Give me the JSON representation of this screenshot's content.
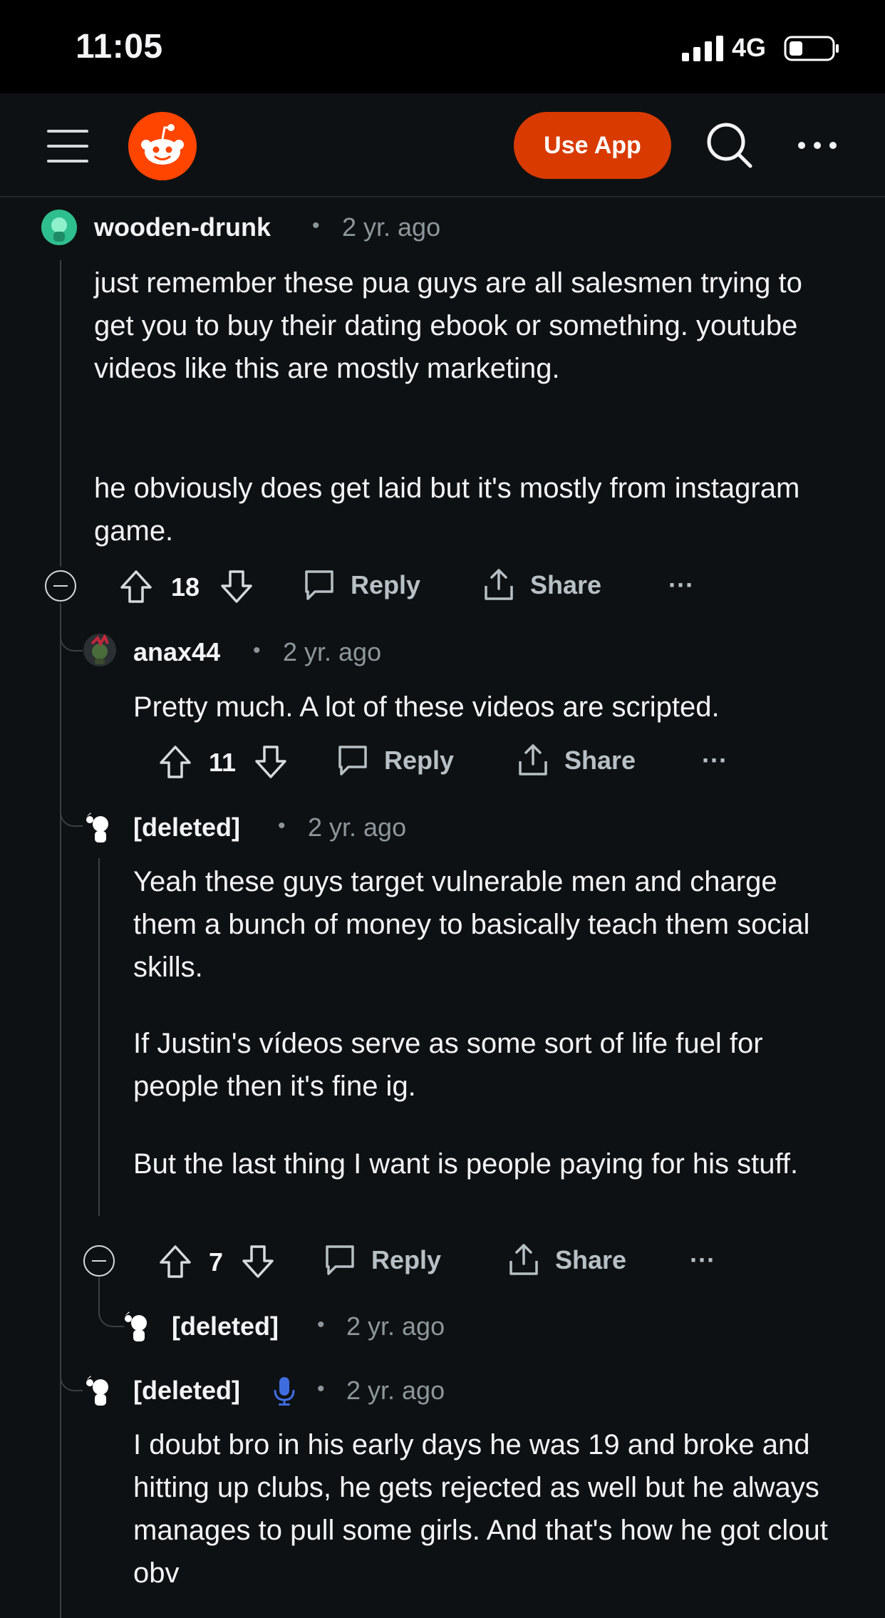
{
  "status_bar": {
    "time": "11:05",
    "network": "4G"
  },
  "nav": {
    "use_app_label": "Use App",
    "logo": "reddit-snoo-logo"
  },
  "actions": {
    "reply_label": "Reply",
    "share_label": "Share",
    "more_label": "···"
  },
  "comments": [
    {
      "author": "wooden-drunk",
      "age": "2 yr. ago",
      "body": [
        "just remember these pua guys are all salesmen trying to get you to buy their dating ebook or something. youtube videos like this are mostly marketing.",
        "he obviously does get laid but it's mostly from instagram game."
      ],
      "score": "18"
    },
    {
      "author": "anax44",
      "age": "2 yr. ago",
      "body": [
        "Pretty much. A lot of these videos are scripted."
      ],
      "score": "11"
    },
    {
      "author": "[deleted]",
      "age": "2 yr. ago",
      "body": [
        "Yeah these guys target vulnerable men and charge them a bunch of money to basically teach them social skills.",
        "If Justin's vídeos serve as some sort of life fuel for people then it's fine ig.",
        "But the last thing I want is people paying for his stuff."
      ],
      "score": "7"
    },
    {
      "author": "[deleted]",
      "age": "2 yr. ago",
      "body": []
    },
    {
      "author": "[deleted]",
      "age": "2 yr. ago",
      "has_mic_icon": true,
      "body": [
        "I doubt bro in his early days he was 19 and broke and hitting up clubs, he gets rejected as well but he always manages to pull some girls. And that's how he got clout obv"
      ]
    }
  ],
  "colors": {
    "background": "#0e1113",
    "accent": "#d93a00",
    "logo": "#ff4500",
    "mic": "#3f6de0"
  }
}
